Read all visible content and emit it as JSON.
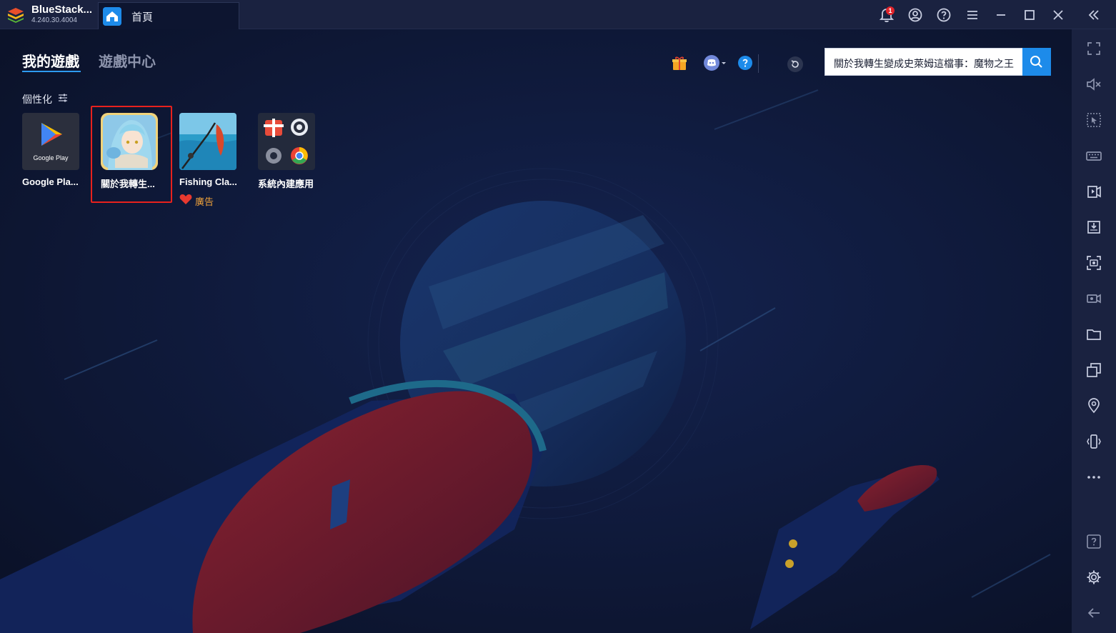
{
  "titlebar": {
    "app_name": "BlueStack...",
    "version": "4.240.30.4004",
    "tab_label": "首頁",
    "notification_count": "1",
    "icons": [
      "notification-bell-icon",
      "account-icon",
      "help-icon",
      "menu-icon",
      "minimize-icon",
      "maximize-icon",
      "close-icon",
      "collapse-sidebar-icon"
    ]
  },
  "nav": {
    "tabs": [
      {
        "label": "我的遊戲",
        "active": true
      },
      {
        "label": "遊戲中心",
        "active": false
      }
    ]
  },
  "personalize_label": "個性化",
  "apps": [
    {
      "label": "Google Pla...",
      "icon_caption": "Google Play"
    },
    {
      "label": "關於我轉生...",
      "selected": true
    },
    {
      "label": "Fishing Cla...",
      "ad_label": "廣告"
    },
    {
      "label": "系統內建應用"
    }
  ],
  "toolbar": {
    "search_value": "關於我轉生變成史萊姆這檔事：魔物之王",
    "icons": [
      "gift-icon",
      "discord-icon",
      "help-icon",
      "refresh-icon",
      "search-icon"
    ]
  },
  "sidebar": {
    "icons": [
      "fullscreen-icon",
      "volume-mute-icon",
      "cursor-select-icon",
      "keyboard-icon",
      "screen-record-icon",
      "apk-install-icon",
      "screenshot-icon",
      "video-record-icon",
      "folder-icon",
      "multi-instance-icon",
      "location-icon",
      "shake-icon",
      "more-icon",
      "help-icon",
      "settings-icon",
      "back-icon"
    ]
  },
  "colors": {
    "accent": "#1d8bea",
    "titlebar": "#1a2240",
    "background": "#0d1530",
    "selection": "#e8211d",
    "ad": "#f2a33a"
  }
}
